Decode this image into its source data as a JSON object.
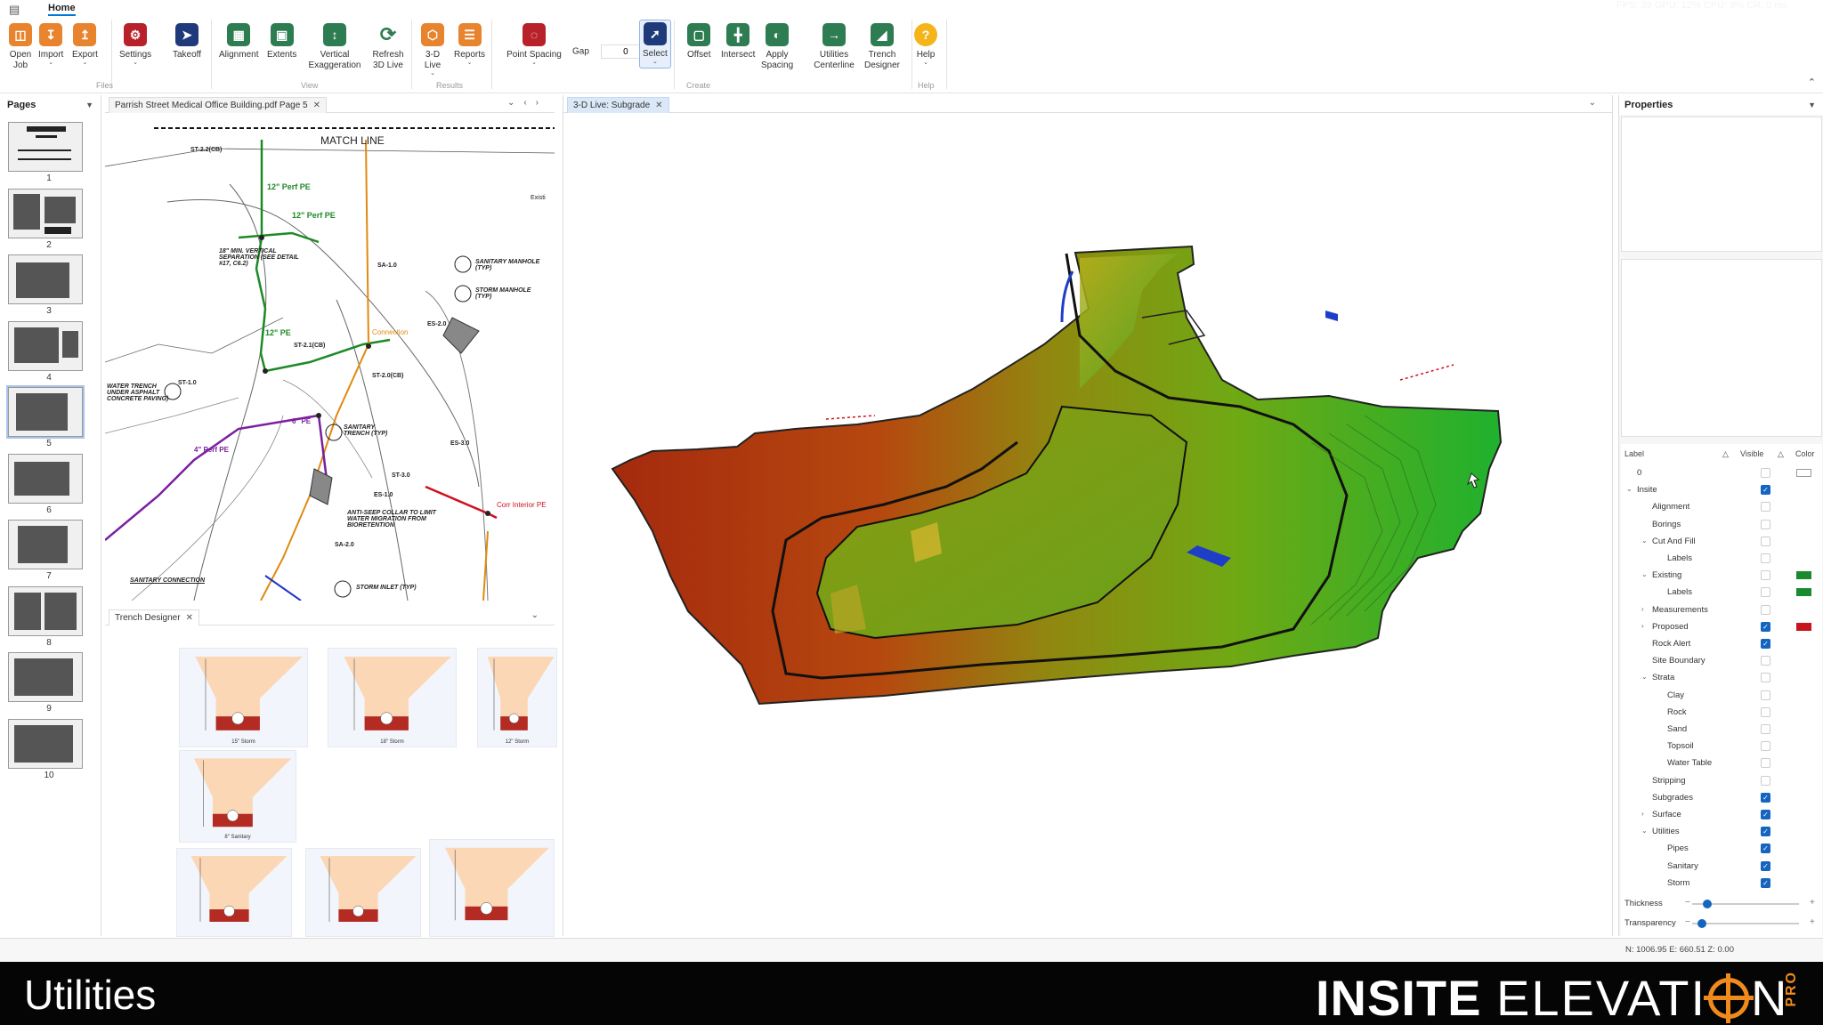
{
  "ribbon": {
    "tab": "Home",
    "fps_readout": "FPS: 39  GPU: 12% CPU: 9% CR: 0 ms",
    "buttons": {
      "open_job": "Open Job",
      "import": "Import",
      "export": "Export",
      "settings": "Settings",
      "takeoff": "Takeoff",
      "alignment": "Alignment",
      "extents": "Extents",
      "vertical_exaggeration": "Vertical Exaggeration",
      "refresh_3d": "Refresh 3D Live",
      "live_3d": "3-D Live",
      "reports": "Reports",
      "point_spacing": "Point Spacing",
      "select": "Select",
      "offset": "Offset",
      "intersect": "Intersect",
      "apply_spacing": "Apply Spacing",
      "utilities_centerline": "Utilities Centerline",
      "trench_designer": "Trench Designer",
      "help": "Help"
    },
    "gap_label": "Gap",
    "gap_value": "0",
    "groups": {
      "files": "Files",
      "view": "View",
      "results": "Results",
      "create": "Create",
      "help": "Help"
    }
  },
  "pages": {
    "title": "Pages",
    "items": [
      "1",
      "2",
      "3",
      "4",
      "5",
      "6",
      "7",
      "8",
      "9",
      "10"
    ],
    "selected": "5"
  },
  "pdf": {
    "tab_label": "Parrish Street Medical Office Building.pdf Page 5",
    "labels": {
      "match_line": "MATCH LINE",
      "perf_pe_1": "12\" Perf PE",
      "perf_pe_2": "12\" Perf PE",
      "sanitary_manhole": "SANITARY MANHOLE (TYP)",
      "storm_manhole": "STORM MANHOLE (TYP)",
      "vertical_sep": "18\" MIN. VERTICAL SEPARATION (SEE DETAIL #17, C6.2)",
      "water_trench": "WATER TRENCH UNDER ASPHALT CONCRETE PAVING)",
      "sanitary_trench": "SANITARY TRENCH (TYP)",
      "anti_seep": "ANTI-SEEP COLLAR TO LIMIT WATER MIGRATION FROM BIORETENTION",
      "storm_inlet": "STORM INLET (TYP)",
      "sanitary_connection": "SANITARY CONNECTION",
      "corr_interior": "Corr Interior PE",
      "connection": "Connection",
      "perf_pe_3": "4\" Perf PE",
      "perf_pe_4": "6\" PE",
      "perf_pe_5": "12\" PE",
      "st_22": "ST-2.2(CB)",
      "st_21": "ST-2.1(CB)",
      "st_20": "ST-2.0(CB)",
      "st_10": "ST-1.0",
      "st_30": "ST-3.0",
      "es_20": "ES-2.0",
      "es_10": "ES-1.0",
      "es_30": "ES-3.0",
      "sa_10": "SA-1.0",
      "sa_20": "SA-2.0",
      "exist": "Existi"
    }
  },
  "trench": {
    "tab_label": "Trench Designer",
    "cards": [
      {
        "caption": "15\" Storm"
      },
      {
        "caption": "18\" Storm"
      },
      {
        "caption": "12\" Storm"
      },
      {
        "caption": "8\" Sanitary"
      },
      {
        "caption": ""
      },
      {
        "caption": ""
      },
      {
        "caption": ""
      }
    ]
  },
  "view3d": {
    "tab_label": "3-D Live: Subgrade"
  },
  "properties": {
    "title": "Properties",
    "col_label": "Label",
    "col_visible": "Visible",
    "col_color": "Color",
    "layers": [
      {
        "label": "0",
        "indent": 0,
        "expander": "",
        "visible": false,
        "color": "#ffffff"
      },
      {
        "label": "Insite",
        "indent": 0,
        "expander": "v",
        "visible": true,
        "color": ""
      },
      {
        "label": "Alignment",
        "indent": 1,
        "expander": "",
        "visible": false,
        "color": ""
      },
      {
        "label": "Borings",
        "indent": 1,
        "expander": "",
        "visible": false,
        "color": ""
      },
      {
        "label": "Cut And Fill",
        "indent": 1,
        "expander": "v",
        "visible": false,
        "color": ""
      },
      {
        "label": "Labels",
        "indent": 2,
        "expander": "",
        "visible": false,
        "color": ""
      },
      {
        "label": "Existing",
        "indent": 1,
        "expander": "v",
        "visible": false,
        "color": "#1a8a2e"
      },
      {
        "label": "Labels",
        "indent": 2,
        "expander": "",
        "visible": false,
        "color": "#1a8a2e"
      },
      {
        "label": "Measurements",
        "indent": 1,
        "expander": ">",
        "visible": false,
        "color": ""
      },
      {
        "label": "Proposed",
        "indent": 1,
        "expander": ">",
        "visible": true,
        "color": "#c8141e"
      },
      {
        "label": "Rock Alert",
        "indent": 1,
        "expander": "",
        "visible": true,
        "color": ""
      },
      {
        "label": "Site Boundary",
        "indent": 1,
        "expander": "",
        "visible": false,
        "color": ""
      },
      {
        "label": "Strata",
        "indent": 1,
        "expander": "v",
        "visible": false,
        "color": ""
      },
      {
        "label": "Clay",
        "indent": 2,
        "expander": "",
        "visible": false,
        "color": ""
      },
      {
        "label": "Rock",
        "indent": 2,
        "expander": "",
        "visible": false,
        "color": ""
      },
      {
        "label": "Sand",
        "indent": 2,
        "expander": "",
        "visible": false,
        "color": ""
      },
      {
        "label": "Topsoil",
        "indent": 2,
        "expander": "",
        "visible": false,
        "color": ""
      },
      {
        "label": "Water Table",
        "indent": 2,
        "expander": "",
        "visible": false,
        "color": ""
      },
      {
        "label": "Stripping",
        "indent": 1,
        "expander": "",
        "visible": false,
        "color": ""
      },
      {
        "label": "Subgrades",
        "indent": 1,
        "expander": "",
        "visible": true,
        "color": ""
      },
      {
        "label": "Surface",
        "indent": 1,
        "expander": ">",
        "visible": true,
        "color": ""
      },
      {
        "label": "Utilities",
        "indent": 1,
        "expander": "v",
        "visible": true,
        "color": ""
      },
      {
        "label": "Pipes",
        "indent": 2,
        "expander": "",
        "visible": true,
        "color": ""
      },
      {
        "label": "Sanitary",
        "indent": 2,
        "expander": "",
        "visible": true,
        "color": ""
      },
      {
        "label": "Storm",
        "indent": 2,
        "expander": "",
        "visible": true,
        "color": ""
      }
    ],
    "thickness_label": "Thickness",
    "thickness_value": 0.1,
    "transparency_label": "Transparency",
    "transparency_value": 0.05
  },
  "status": {
    "coords": "N: 1006.95  E: 660.51  Z: 0.00"
  },
  "footer": {
    "title": "Utilities",
    "brand_bold": "INSITE",
    "brand_light": "ELEVATI",
    "brand_end": "N",
    "brand_pro": "PRO"
  },
  "colors": {
    "accent": "#1565c0",
    "ribbon_orange": "#e8832e",
    "ribbon_green": "#2e7d52",
    "ribbon_red": "#b8202a",
    "brand_orange": "#f08a1c"
  }
}
